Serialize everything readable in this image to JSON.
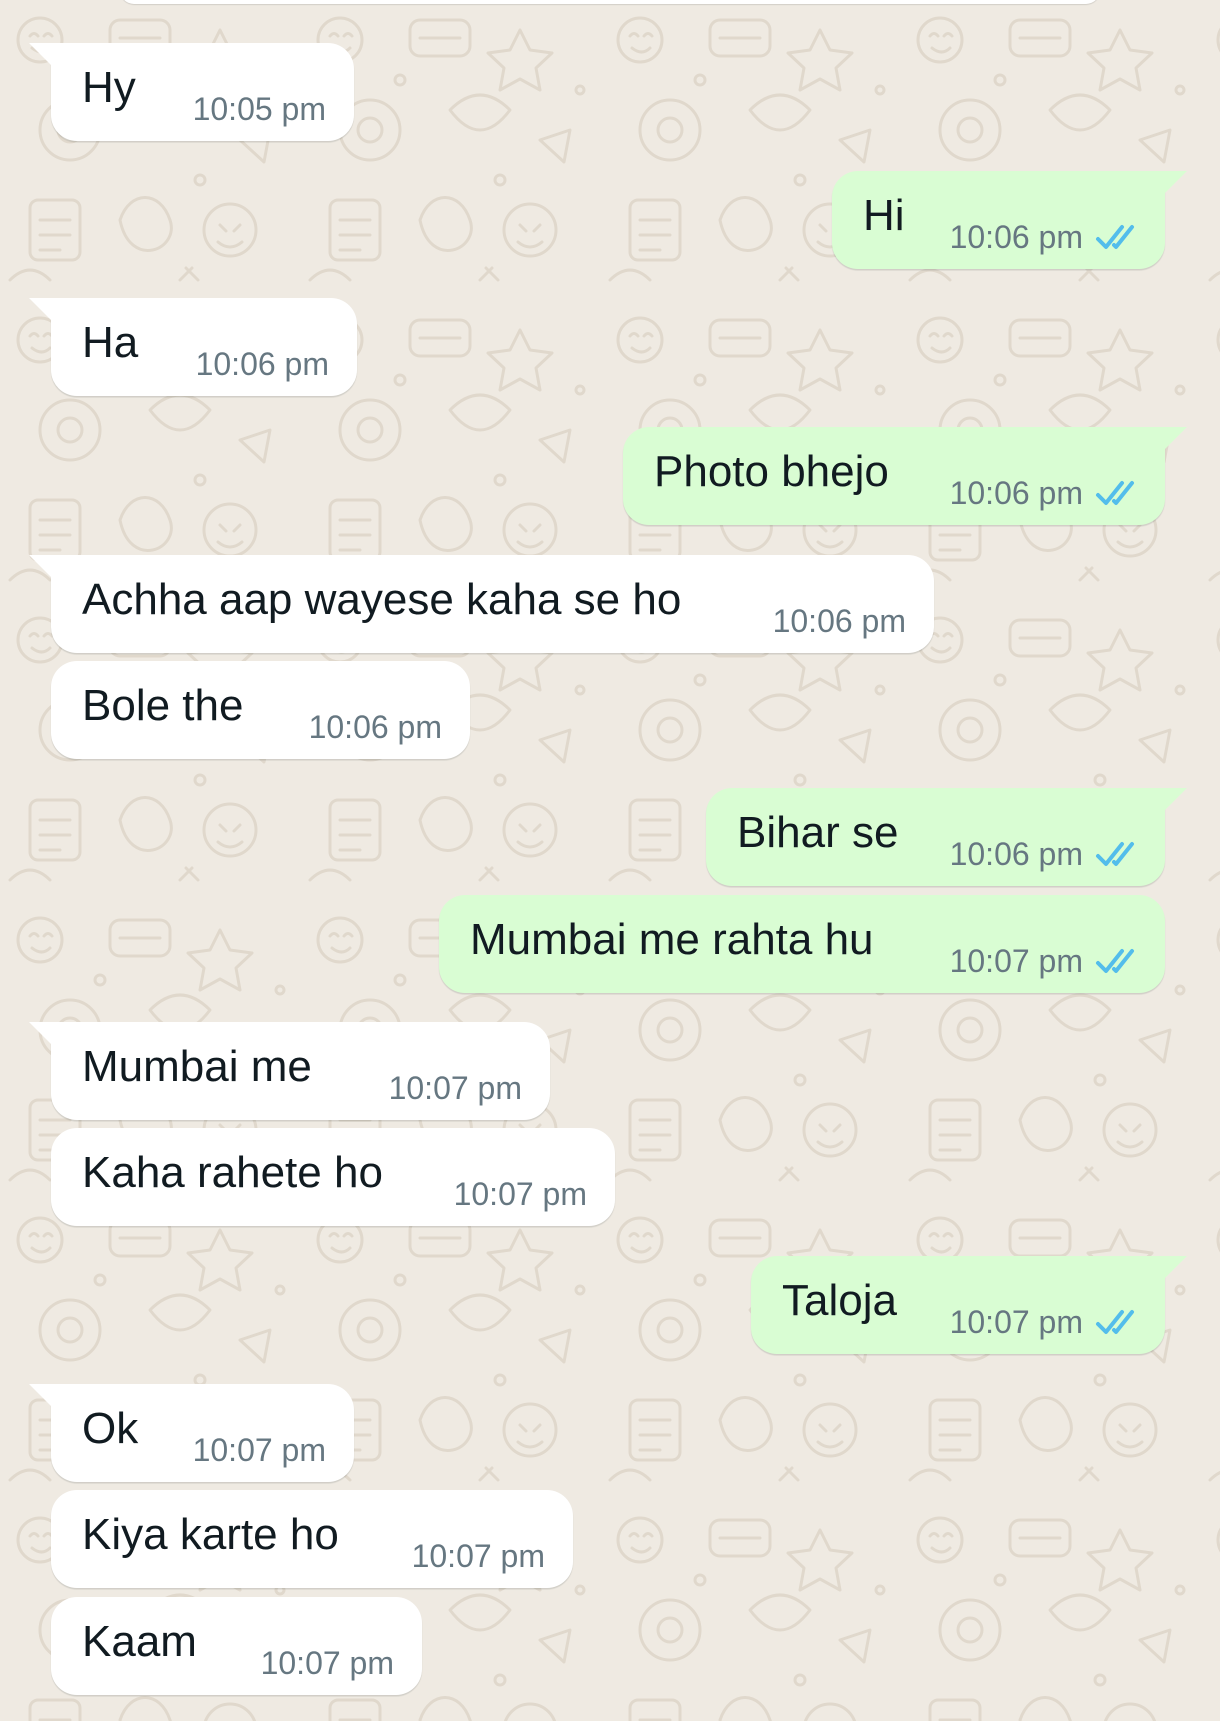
{
  "colors": {
    "background": "#efeae2",
    "incoming_bubble": "#ffffff",
    "outgoing_bubble": "#d9fdd3",
    "message_text": "#111b21",
    "timestamp_text": "#667781",
    "read_ticks": "#53bdeb"
  },
  "icons": {
    "read_receipt": "double-check-icon"
  },
  "messages": [
    {
      "direction": "incoming",
      "text": "Hy",
      "time": "10:05 pm"
    },
    {
      "direction": "outgoing",
      "text": "Hi",
      "time": "10:06 pm",
      "status": "read"
    },
    {
      "direction": "incoming",
      "text": "Ha",
      "time": "10:06 pm"
    },
    {
      "direction": "outgoing",
      "text": "Photo bhejo",
      "time": "10:06 pm",
      "status": "read"
    },
    {
      "direction": "incoming",
      "text": "Achha aap wayese kaha se ho",
      "time": "10:06 pm"
    },
    {
      "direction": "incoming",
      "text": "Bole the",
      "time": "10:06 pm"
    },
    {
      "direction": "outgoing",
      "text": "Bihar se",
      "time": "10:06 pm",
      "status": "read"
    },
    {
      "direction": "outgoing",
      "text": "Mumbai me rahta hu",
      "time": "10:07 pm",
      "status": "read"
    },
    {
      "direction": "incoming",
      "text": "Mumbai me",
      "time": "10:07 pm"
    },
    {
      "direction": "incoming",
      "text": "Kaha rahete ho",
      "time": "10:07 pm"
    },
    {
      "direction": "outgoing",
      "text": "Taloja",
      "time": "10:07 pm",
      "status": "read"
    },
    {
      "direction": "incoming",
      "text": "Ok",
      "time": "10:07 pm"
    },
    {
      "direction": "incoming",
      "text": "Kiya karte ho",
      "time": "10:07 pm"
    },
    {
      "direction": "incoming",
      "text": "Kaam",
      "time": "10:07 pm"
    }
  ]
}
